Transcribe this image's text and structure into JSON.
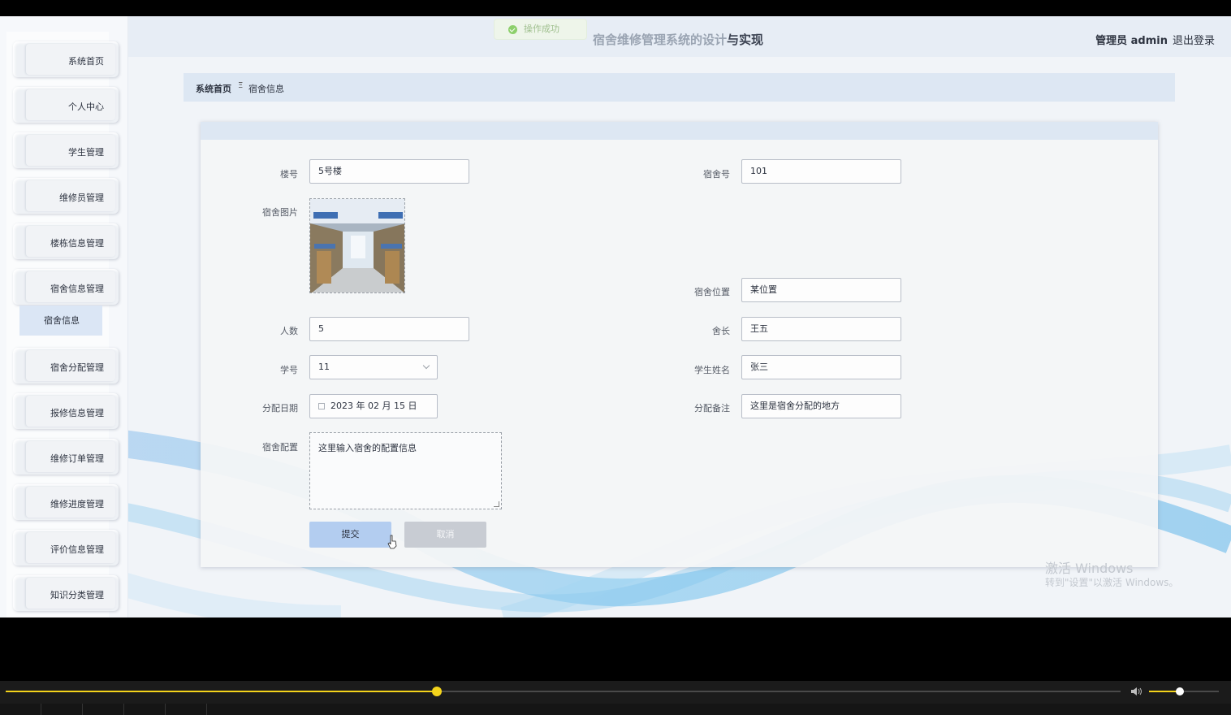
{
  "header": {
    "title_light": "宿舍维修管理系统的设计",
    "title_dark": "与实现",
    "user": "管理员 admin",
    "logout": "退出登录"
  },
  "toast": {
    "text": "操作成功"
  },
  "sidebar": {
    "items": [
      {
        "label": "系统首页"
      },
      {
        "label": "个人中心"
      },
      {
        "label": "学生管理"
      },
      {
        "label": "维修员管理"
      },
      {
        "label": "楼栋信息管理"
      },
      {
        "label": "宿舍信息管理"
      },
      {
        "label": "宿舍分配管理"
      },
      {
        "label": "报修信息管理"
      },
      {
        "label": "维修订单管理"
      },
      {
        "label": "维修进度管理"
      },
      {
        "label": "评价信息管理"
      },
      {
        "label": "知识分类管理"
      }
    ],
    "submenu": {
      "label": "宿舍信息"
    }
  },
  "breadcrumb": {
    "home": "系统首页",
    "sep": "Ξ",
    "current": "宿舍信息"
  },
  "form": {
    "building": {
      "label": "楼号",
      "value": "5号楼"
    },
    "dorm_no": {
      "label": "宿舍号",
      "value": "101"
    },
    "photo": {
      "label": "宿舍图片"
    },
    "location": {
      "label": "宿舍位置",
      "value": "某位置"
    },
    "count": {
      "label": "人数",
      "value": "5"
    },
    "leader": {
      "label": "舍长",
      "value": "王五"
    },
    "student_id": {
      "label": "学号",
      "value": "11"
    },
    "student_name": {
      "label": "学生姓名",
      "value": "张三"
    },
    "date": {
      "label": "分配日期",
      "value": "2023 年 02 月 15 日"
    },
    "note": {
      "label": "分配备注",
      "value": "这里是宿舍分配的地方"
    },
    "config": {
      "label": "宿舍配置",
      "value": "这里输入宿舍的配置信息"
    },
    "submit": "提交",
    "cancel": "取消"
  },
  "watermark": {
    "line1": "激活 Windows",
    "line2": "转到\"设置\"以激活 Windows。"
  },
  "player": {
    "progress": 0.387,
    "volume": 0.44
  },
  "colors": {
    "accent": "#f3d31b",
    "header_bg": "#e7edf5",
    "submit_bg": "#b3cdf0"
  }
}
